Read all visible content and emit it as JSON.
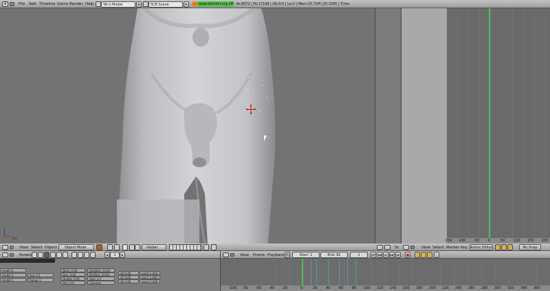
{
  "topbar": {
    "info_icon": "i",
    "menus": [
      "File",
      "Add",
      "Timeline",
      "Game",
      "Render",
      "Help"
    ],
    "screen_selector": "SR:2-Model",
    "scene_selector": "SCE:Scene",
    "link": "www.blender.org 249.2",
    "stats": "Ve:9072 | Fa:17199 | Ob:9-0 | La:0 | Mem:25.72M (20.31M) | Time:"
  },
  "viewport": {
    "frame_label": "(1)",
    "header": {
      "view_menu": "View",
      "select_menu": "Select",
      "object_menu": "Object",
      "mode_select": "Object Mode",
      "orientation_select": "Global"
    }
  },
  "action_editor": {
    "ticks": [
      "-150",
      "-100",
      "-50",
      "0",
      "50",
      "100",
      "150",
      "200"
    ],
    "header": {
      "view_menu": "View",
      "select_menu": "Select",
      "marker_menu": "Marker",
      "key_menu": "Key",
      "editor_select": "Action Editor",
      "snap_select": "No Snap"
    }
  },
  "small_panel_header": {
    "label": "Sc"
  },
  "buttons_window": {
    "panels_label": "Panels",
    "frame_value": "1",
    "fields_col1": [
      "AmbR 0.",
      "AmbG 0.",
      "AmbB 0."
    ],
    "fields_col2": [
      "Exp 1.0",
      "Range 1."
    ],
    "fields_col3": [
      "Start: 0.00",
      "Dist: 0.00",
      "Height: 0.00",
      "Misi: 0.0"
    ],
    "fields_col4": [
      "StarDist: 15.00",
      "MinDist: 10.00",
      "Size: 2.0",
      "Colnoise"
    ],
    "fields_col5": [
      "dX 0.00",
      "dY 0.00",
      "dZ 0.00"
    ],
    "fields_col6": [
      "sizeX 1.000",
      "sizeY 1.000",
      "sizeZ 1.000"
    ]
  },
  "timeline": {
    "menus": [
      "View",
      "Frame",
      "Playback"
    ],
    "pr_label": "Pr",
    "start": "Start: 1",
    "end": "End: 82",
    "current": "1",
    "ticks": [
      "-100",
      "-80",
      "-60",
      "-40",
      "-20",
      "0",
      "20",
      "40",
      "60",
      "80",
      "100",
      "120",
      "140",
      "160",
      "180",
      "200",
      "220",
      "240",
      "260",
      "280",
      "300",
      "320",
      "340",
      "360"
    ]
  }
}
